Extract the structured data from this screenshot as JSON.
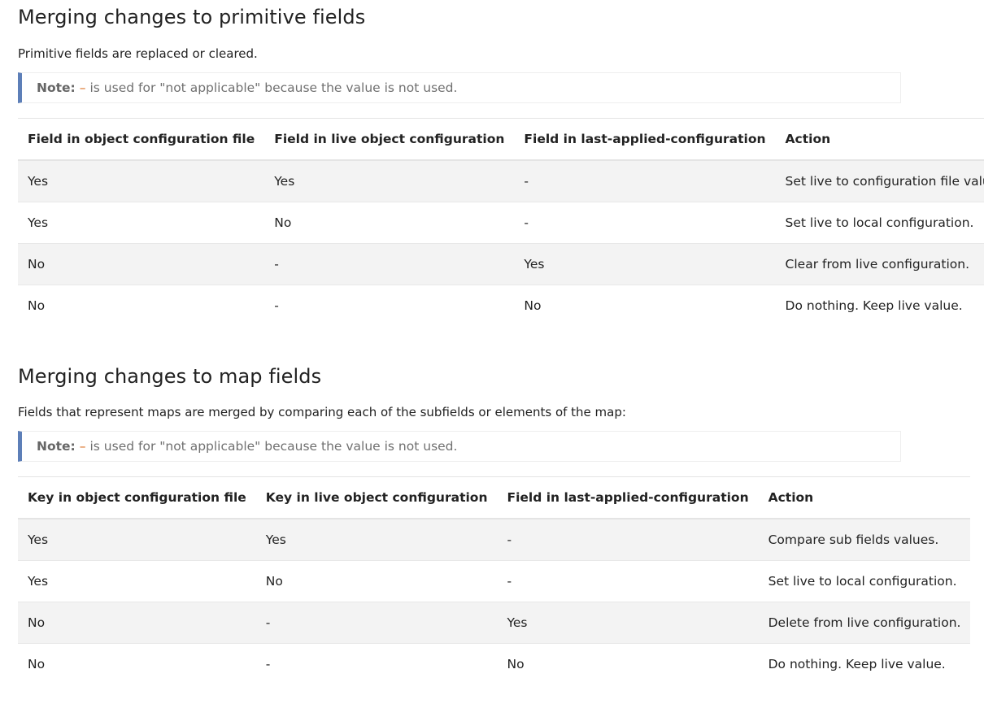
{
  "primitive": {
    "title": "Merging changes to primitive fields",
    "description": "Primitive fields are replaced or cleared.",
    "note": {
      "label": "Note:",
      "dash": "–",
      "text": "is used for \"not applicable\" because the value is not used."
    },
    "columns": [
      "Field in object configuration file",
      "Field in live object configuration",
      "Field in last-applied-configuration",
      "Action"
    ],
    "rows": [
      [
        "Yes",
        "Yes",
        "-",
        "Set live to configuration file value."
      ],
      [
        "Yes",
        "No",
        "-",
        "Set live to local configuration."
      ],
      [
        "No",
        "-",
        "Yes",
        "Clear from live configuration."
      ],
      [
        "No",
        "-",
        "No",
        "Do nothing. Keep live value."
      ]
    ]
  },
  "map": {
    "title": "Merging changes to map fields",
    "description": "Fields that represent maps are merged by comparing each of the subfields or elements of the map:",
    "note": {
      "label": "Note:",
      "dash": "–",
      "text": "is used for \"not applicable\" because the value is not used."
    },
    "columns": [
      "Key in object configuration file",
      "Key in live object configuration",
      "Field in last-applied-configuration",
      "Action"
    ],
    "rows": [
      [
        "Yes",
        "Yes",
        "-",
        "Compare sub fields values."
      ],
      [
        "Yes",
        "No",
        "-",
        "Set live to local configuration."
      ],
      [
        "No",
        "-",
        "Yes",
        "Delete from live configuration."
      ],
      [
        "No",
        "-",
        "No",
        "Do nothing. Keep live value."
      ]
    ]
  },
  "colors": {
    "note_border": "#5d7fb8",
    "note_dash": "#d96c1f",
    "zebra_row": "#f3f3f3"
  }
}
